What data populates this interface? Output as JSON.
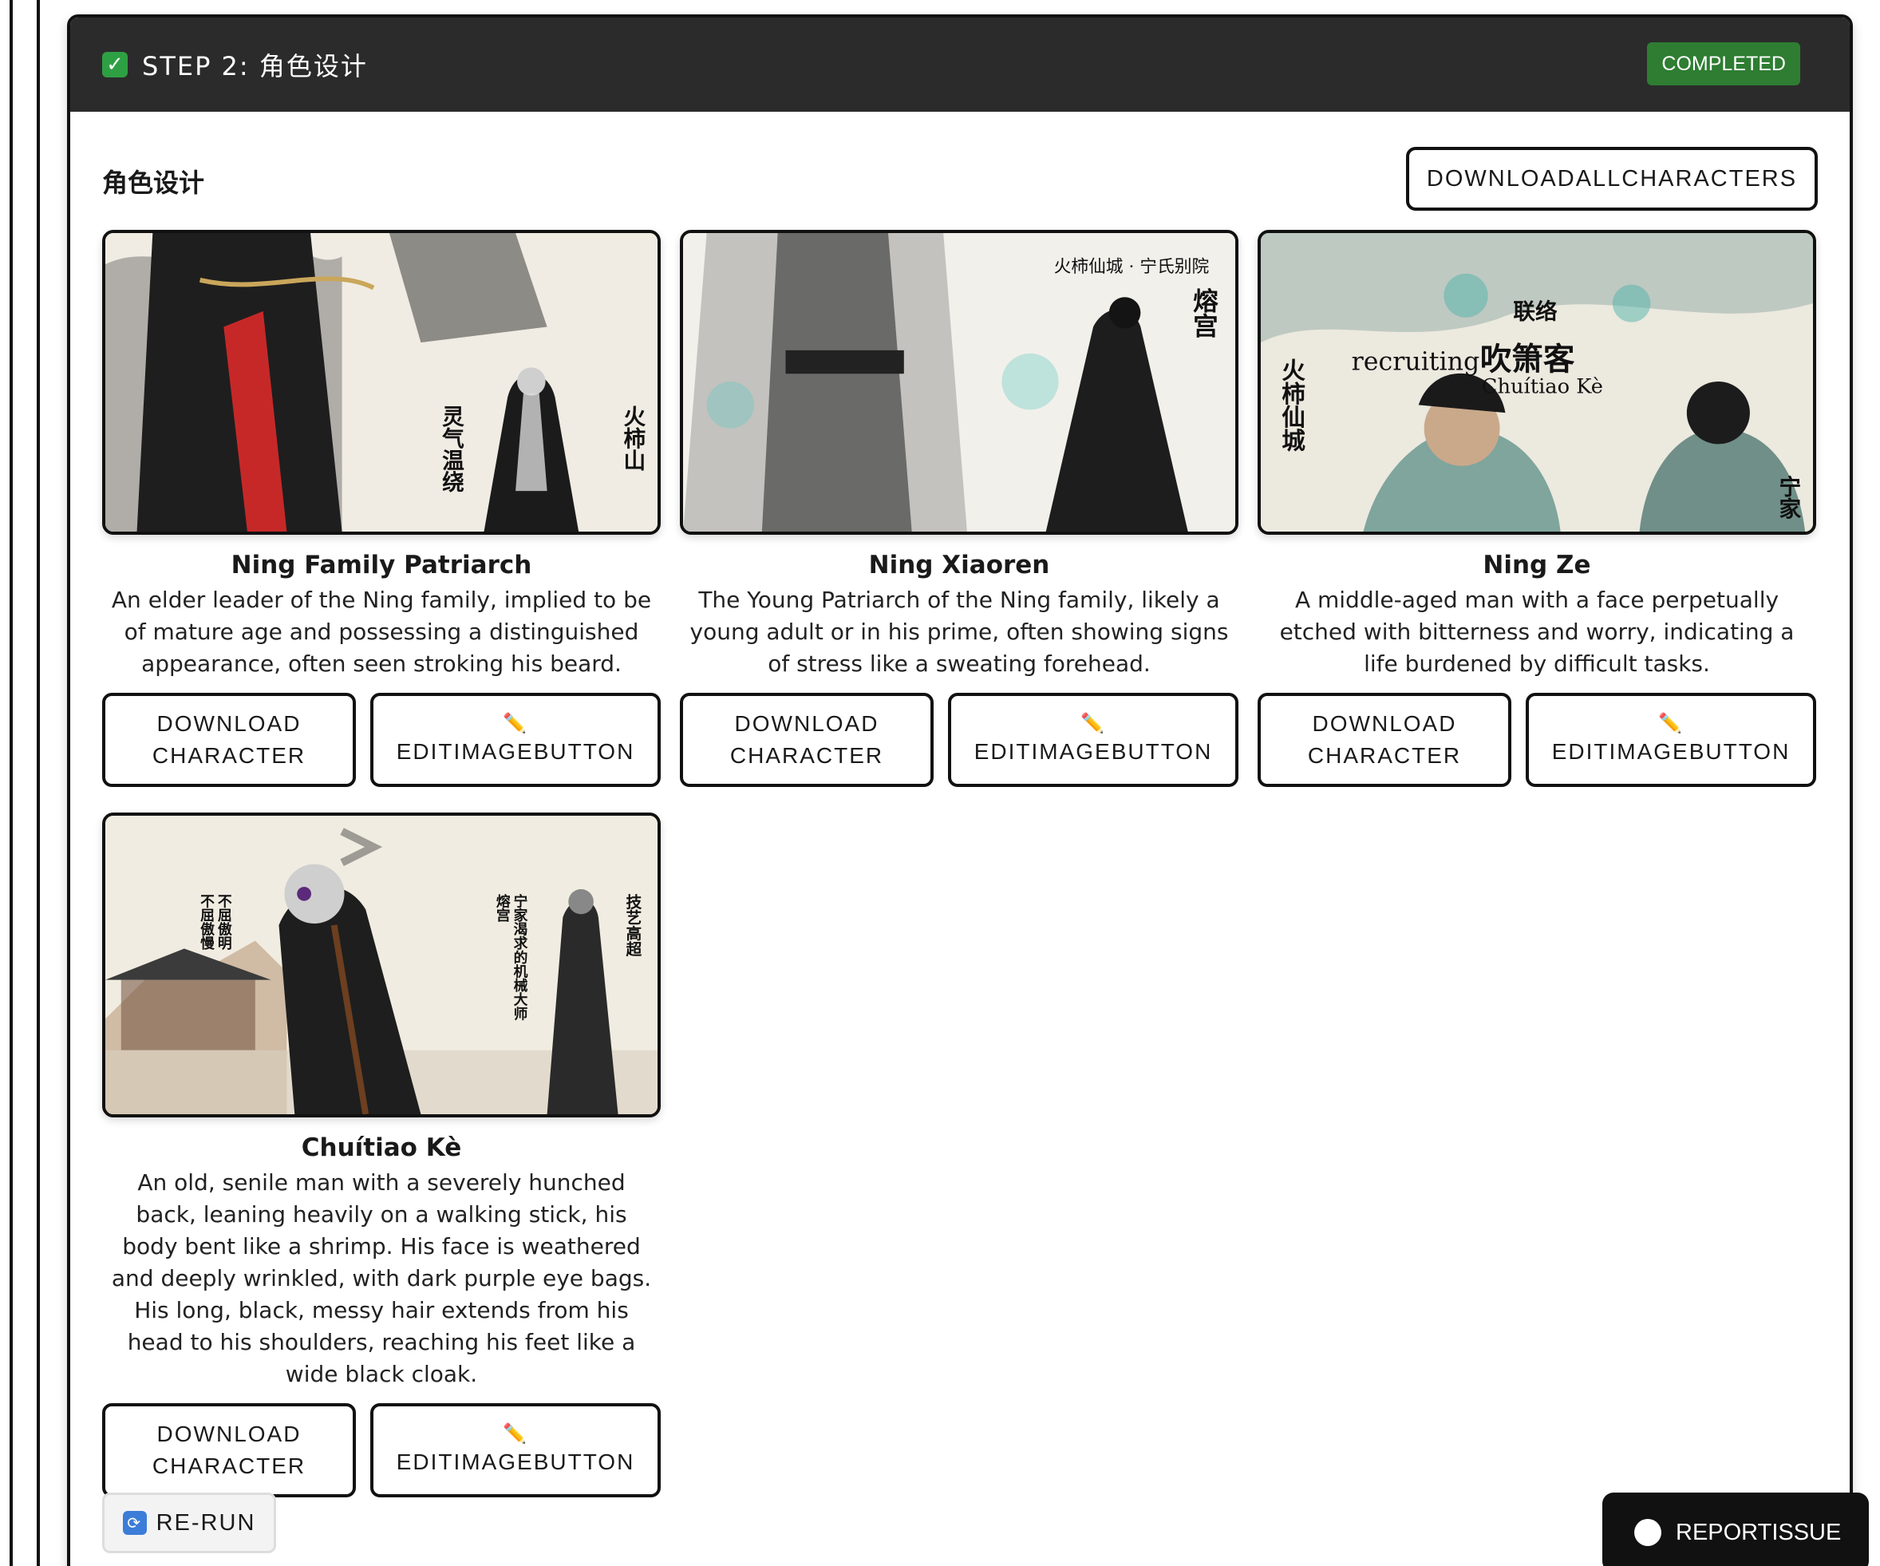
{
  "header": {
    "step_title": "STEP 2: 角色设计",
    "status": "COMPLETED",
    "check_icon": "check-box-icon"
  },
  "section": {
    "title": "角色设计",
    "download_all_label": "DOWNLOADALLCHARACTERS"
  },
  "characters": [
    {
      "name": "Ning Family Patriarch",
      "description": "An elder leader of the Ning family, implied to be of mature age and possessing a distinguished appearance, often seen stroking his beard.",
      "image_text": [
        "灵气温绕",
        "火柿山"
      ]
    },
    {
      "name": "Ning Xiaoren",
      "description": "The Young Patriarch of the Ning family, likely a young adult or in his prime, often showing signs of stress like a sweating forehead.",
      "image_text": [
        "火柿仙城 · 宁氏别院",
        "熔宫"
      ]
    },
    {
      "name": "Ning Ze",
      "description": "A middle-aged man with a face perpetually etched with bitterness and worry, indicating a life burdened by difficult tasks.",
      "image_text": [
        "联络",
        "recruiting",
        "吹箫客",
        "Chuítiao Kè",
        "火柿仙城",
        "宁家"
      ]
    },
    {
      "name": "Chuítiao Kè",
      "description": "An old, senile man with a severely hunched back, leaning heavily on a walking stick, his body bent like a shrimp. His face is weathered and deeply wrinkled, with dark purple eye bags. His long, black, messy hair extends from his head to his shoulders, reaching his feet like a wide black cloak.",
      "image_text": [
        "不屈傲明",
        "不屈傲慢",
        "宁家渴求的机械大师",
        "熔宫",
        "技艺高超"
      ]
    }
  ],
  "actions": {
    "download_label": "DOWNLOAD CHARACTER",
    "edit_label": "EDITIMAGEBUTTON",
    "edit_icon": "✏️"
  },
  "footer": {
    "rerun_label": "RE-RUN",
    "rerun_icon": "🔄",
    "report_label": "REPORTISSUE"
  },
  "colors": {
    "header_bg": "#2b2b2b",
    "completed_badge": "#2e7d32",
    "ink_black": "#111111",
    "accent_red": "#c62828",
    "accent_teal": "#4fb3a9"
  }
}
